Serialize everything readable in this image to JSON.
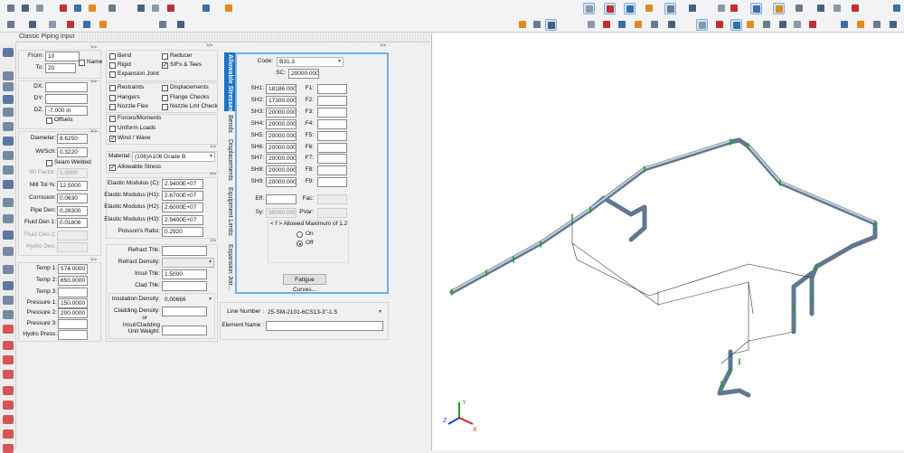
{
  "panel_title": "Classic Piping Input",
  "more": ">>",
  "nodes": {
    "from_label": "From:",
    "from": "10",
    "to_label": "To:",
    "to": "20",
    "name_label": "Name"
  },
  "deltas": {
    "dx_label": "DX:",
    "dx": "",
    "dy_label": "DY:",
    "dy": "",
    "dz_label": "DZ:",
    "dz": "-7.000 in",
    "offsets_label": "Offsets"
  },
  "pipe": {
    "diameter_label": "Diameter:",
    "diameter": "8.6250",
    "wtsch_label": "Wt/Sch:",
    "wtsch": "0.3220",
    "seam_label": "Seam Welded",
    "wtfactor_label": "Wl Factor:",
    "wtfactor": "1.0000",
    "milltol_label": "Mill Tol %:",
    "milltol": "12.5000",
    "corrosion_label": "Corrosion:",
    "corrosion": "0.0630",
    "pipeden_label": "Pipe Den:",
    "pipeden": "0.28300",
    "fluid1_label": "Fluid Den 1:",
    "fluid1": "0.01806",
    "fluid2_label": "Fluid Den 2:",
    "hydroden_label": "Hydro Den:"
  },
  "operating": {
    "temp1_label": "Temp 1:",
    "temp1": "574.0000",
    "temp2_label": "Temp 2:",
    "temp2": "650.0000",
    "temp3_label": "Temp 3:",
    "temp3": "",
    "p1_label": "Pressure 1:",
    "p1": "150.0000",
    "p2_label": "Pressure 2:",
    "p2": "200.0000",
    "p3_label": "Pressure 3:",
    "p3": "",
    "hydro_label": "Hydro Press:",
    "hydro": ""
  },
  "checks": [
    {
      "label": "Bend",
      "checked": false
    },
    {
      "label": "Reducer",
      "checked": false
    },
    {
      "label": "Rigid",
      "checked": false
    },
    {
      "label": "SIFs & Tees",
      "checked": true
    },
    {
      "label": "Expansion Joint",
      "checked": false
    },
    {
      "label": "Restraints",
      "checked": false
    },
    {
      "label": "Displacements",
      "checked": false
    },
    {
      "label": "Hangers",
      "checked": false
    },
    {
      "label": "Flange Checks",
      "checked": false
    },
    {
      "label": "Nozzle Flex",
      "checked": false
    },
    {
      "label": "Nozzle Lmt Check",
      "checked": false
    },
    {
      "label": "Forces/Moments",
      "checked": false
    },
    {
      "label": "Uniform Loads",
      "checked": false
    },
    {
      "label": "Wind / Wave",
      "checked": true
    }
  ],
  "material": {
    "label": "Material:",
    "value": "(106)A106 Grade B",
    "allowable_label": "Allowable Stress"
  },
  "elastic": {
    "c_label": "Elastic Modulus (C):",
    "c": "2.9400E+07",
    "h1_label": "Elastic Modulus (H1):",
    "h1": "2.6700E+07",
    "h2_label": "Elastic Modulus (H2):",
    "h2": "2.6000E+07",
    "h3_label": "Elastic Modulus (H3):",
    "h3": "2.9400E+07",
    "poisson_label": "Poisson's Ratio:",
    "poisson": "0.2920"
  },
  "insulation": {
    "refract_thk_label": "Refract Thk:",
    "refract_den_label": "Refract Density:",
    "insul_thk_label": "Insul Thk:",
    "insul_thk": "1.5000",
    "clad_thk_label": "Clad Thk:",
    "insul_den_label": "Insulation Density:",
    "insul_den": "0.00666",
    "clad_den_label": "Cladding Density:",
    "or_label": "or",
    "unit_wt_label1": "Insul/Cladding",
    "unit_wt_label2": "Unit Weight:"
  },
  "tabs": [
    "Allowable Stresses",
    "Bends",
    "Displacements",
    "Equipment Limits",
    "Expansion Joir..."
  ],
  "stress": {
    "code_label": "Code:",
    "code": "B31.3",
    "sc_label": "SC:",
    "sc": "20000.000",
    "sh": [
      {
        "l": "SH1:",
        "v": "18186.000"
      },
      {
        "l": "SH2:",
        "v": "17300.000"
      },
      {
        "l": "SH3:",
        "v": "20000.000"
      },
      {
        "l": "SH4:",
        "v": "20000.000"
      },
      {
        "l": "SH5:",
        "v": "20000.000"
      },
      {
        "l": "SH6:",
        "v": "20000.000"
      },
      {
        "l": "SH7:",
        "v": "20000.000"
      },
      {
        "l": "SH8:",
        "v": "20000.000"
      },
      {
        "l": "SH9:",
        "v": "20000.000"
      }
    ],
    "f": [
      "F1:",
      "F2:",
      "F3:",
      "F4:",
      "F5:",
      "F6:",
      "F7:",
      "F8:",
      "F9:"
    ],
    "eff_label": "Eff:",
    "fac_label": "Fac:",
    "sy_label": "Sy:",
    "sy": "35000.000",
    "pvar_label": "PVar:",
    "fmax_label": "< f > Allowed Maximum of 1.2",
    "on_label": "On",
    "off_label": "Off",
    "fatigue_button": "Fatigue Curves..."
  },
  "line": {
    "line_number_label": "Line Number :",
    "line_number": "25-SM-2101-6CS13-3\"-1.5",
    "element_name_label": "Element Name :",
    "element_name": ""
  },
  "axes": {
    "x": "X",
    "y": "Y",
    "z": "Z"
  },
  "colors": {
    "accent": "#1c73c8",
    "pipe": "#7f95ad",
    "support": "#1aa31a"
  }
}
